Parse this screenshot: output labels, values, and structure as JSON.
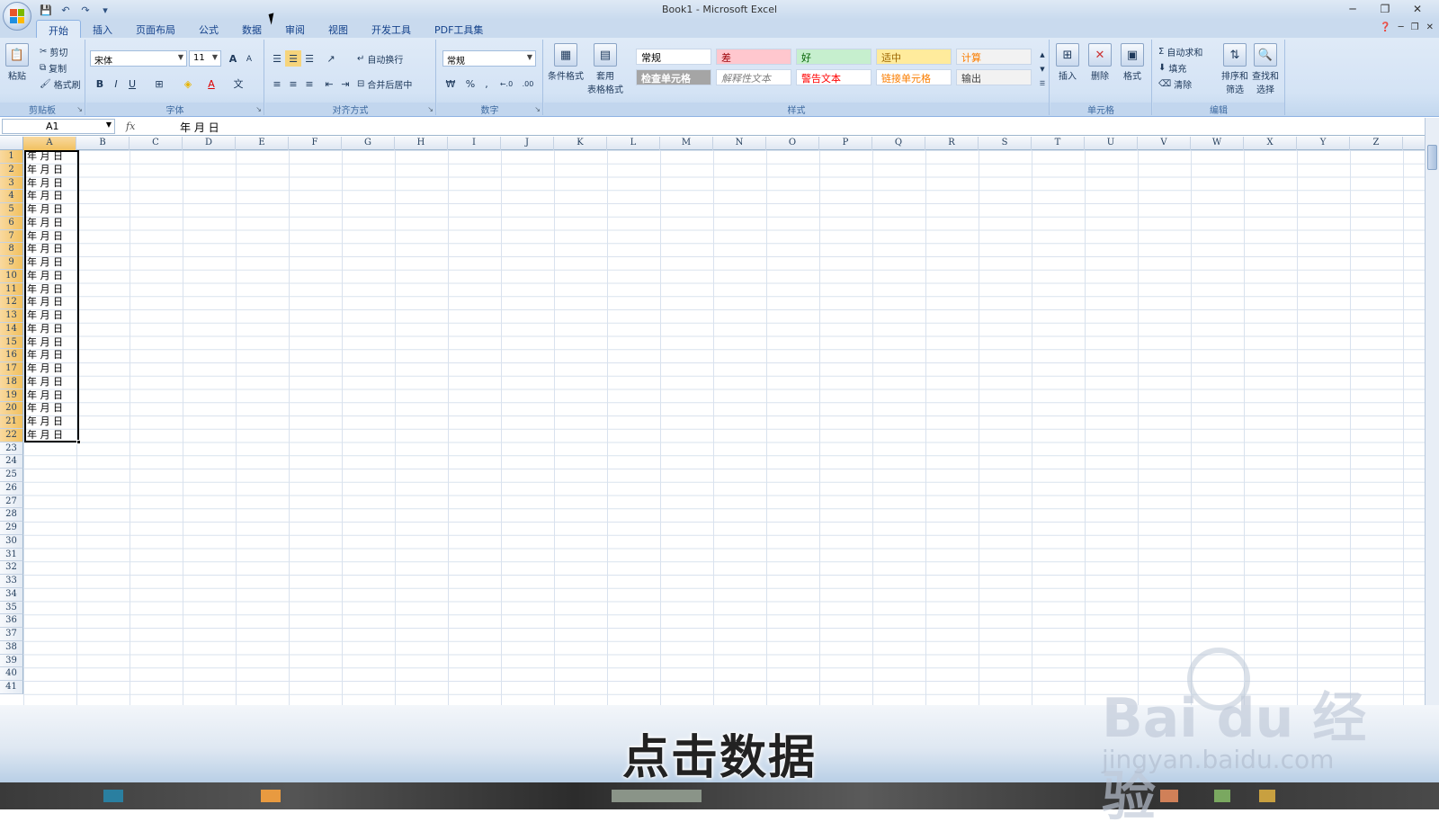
{
  "window": {
    "title": "Book1 - Microsoft Excel",
    "controls": [
      "─",
      "❐",
      "✕"
    ]
  },
  "qat": {
    "save": "💾",
    "undo": "↶",
    "redo": "↷",
    "more": "▾"
  },
  "tabs": [
    "开始",
    "插入",
    "页面布局",
    "公式",
    "数据",
    "审阅",
    "视图",
    "开发工具",
    "PDF工具集"
  ],
  "active_tab": "开始",
  "ribbon": {
    "clipboard": {
      "label": "剪贴板",
      "paste": "粘贴",
      "cut": "剪切",
      "copy": "复制",
      "format_painter": "格式刷"
    },
    "font": {
      "label": "字体",
      "font_name": "宋体",
      "font_size": "11",
      "bold": "B",
      "italic": "I",
      "underline": "U",
      "grow": "A",
      "shrink": "A"
    },
    "alignment": {
      "label": "对齐方式",
      "wrap": "自动换行",
      "merge": "合并后居中"
    },
    "number": {
      "label": "数字",
      "format": "常规",
      "percent": "%",
      "comma": ",",
      "inc": "←.0",
      "dec": ".00"
    },
    "styles": {
      "label": "样式",
      "conditional": "条件格式",
      "table_format": "套用",
      "table_format2": "表格格式",
      "cells": [
        {
          "text": "常规",
          "bg": "#ffffff",
          "color": "#000000"
        },
        {
          "text": "差",
          "bg": "#ffc7ce",
          "color": "#9c0006"
        },
        {
          "text": "好",
          "bg": "#c6efce",
          "color": "#006100"
        },
        {
          "text": "适中",
          "bg": "#ffeb9c",
          "color": "#9c6500"
        },
        {
          "text": "计算",
          "bg": "#f2f2f2",
          "color": "#fa7d00"
        },
        {
          "text": "检查单元格",
          "bg": "#a5a5a5",
          "color": "#ffffff"
        },
        {
          "text": "解释性文本",
          "bg": "#ffffff",
          "color": "#7f7f7f"
        },
        {
          "text": "警告文本",
          "bg": "#ffffff",
          "color": "#ff0000"
        },
        {
          "text": "链接单元格",
          "bg": "#ffffff",
          "color": "#fa7d00"
        },
        {
          "text": "输出",
          "bg": "#f2f2f2",
          "color": "#3f3f3f"
        }
      ]
    },
    "cells_group": {
      "label": "单元格",
      "insert": "插入",
      "delete": "删除",
      "format": "格式"
    },
    "editing": {
      "label": "编辑",
      "autosum": "自动求和",
      "fill": "填充",
      "clear": "清除",
      "sort": "排序和",
      "sort2": "筛选",
      "find": "查找和",
      "find2": "选择"
    }
  },
  "formula_bar": {
    "name_box": "A1",
    "fx": "fx",
    "content": "年 月 日"
  },
  "columns": [
    "A",
    "B",
    "C",
    "D",
    "E",
    "F",
    "G",
    "H",
    "I",
    "J",
    "K",
    "L",
    "M",
    "N",
    "O",
    "P",
    "Q",
    "R",
    "S",
    "T",
    "U",
    "V",
    "W",
    "X",
    "Y",
    "Z"
  ],
  "rows": [
    "1",
    "2",
    "3",
    "4",
    "5",
    "6",
    "7",
    "8",
    "9",
    "10",
    "11",
    "12",
    "13",
    "14",
    "15",
    "16",
    "17",
    "18",
    "19",
    "20",
    "21",
    "22",
    "23",
    "24",
    "25",
    "26",
    "27",
    "28",
    "29",
    "30",
    "31",
    "32",
    "33",
    "34",
    "35",
    "36",
    "37",
    "38",
    "39",
    "40",
    "41"
  ],
  "column_a_values": [
    "年 月 日",
    "年 月 日",
    "年 月 日",
    "年 月 日",
    "年 月 日",
    "年 月 日",
    "年 月 日",
    "年 月 日",
    "年 月 日",
    "年 月 日",
    "年 月 日",
    "年 月 日",
    "年 月 日",
    "年 月 日",
    "年 月 日",
    "年 月 日",
    "年 月 日",
    "年 月 日",
    "年 月 日",
    "年 月 日",
    "年 月 日",
    "年 月 日"
  ],
  "subtitle": "点击数据",
  "watermark": {
    "main": "Bai du 经验",
    "url": "jingyan.baidu.com"
  }
}
